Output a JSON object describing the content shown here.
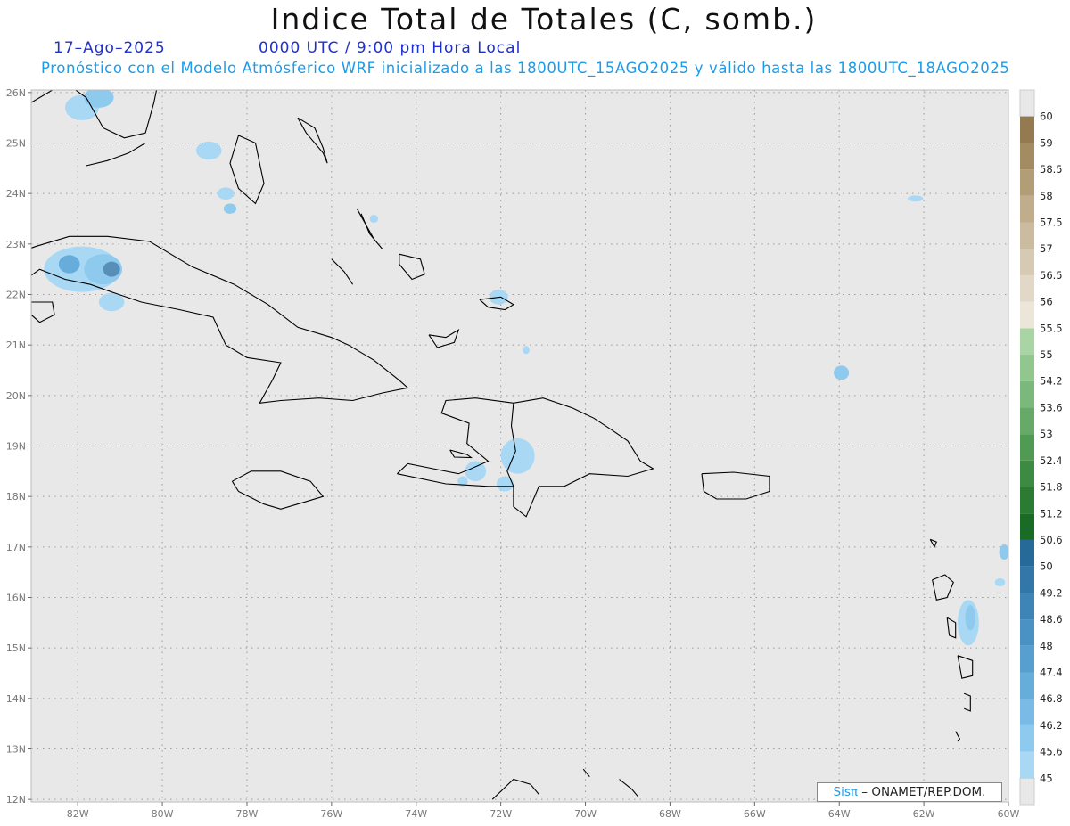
{
  "title": "Indice Total de Totales (C, somb.)",
  "date": "17–Ago–2025",
  "time": "0000 UTC / 9:00 pm Hora Local",
  "subtitle": "Pronóstico con el Modelo Atmósferico WRF inicializado a las 1800UTC_15AGO2025 y válido hasta las  1800UTC_18AGO2025",
  "credit_brand": "Sisπ",
  "credit_text": " – ONAMET/REP.DOM.",
  "map": {
    "lon_labels": [
      "82W",
      "80W",
      "78W",
      "76W",
      "74W",
      "72W",
      "70W",
      "68W",
      "66W",
      "64W",
      "62W",
      "60W"
    ],
    "lat_labels": [
      "26N",
      "25N",
      "24N",
      "23N",
      "22N",
      "21N",
      "20N",
      "19N",
      "18N",
      "17N",
      "16N",
      "15N",
      "14N",
      "13N",
      "12N"
    ],
    "lon_range": [
      -83.1,
      -60.0
    ],
    "lat_range": [
      11.95,
      26.05
    ],
    "background": "#e8e8e8",
    "coast_color": "#000000"
  },
  "colorbar": {
    "levels": [
      "45",
      "45.6",
      "46.2",
      "46.8",
      "47.4",
      "48",
      "48.6",
      "49.2",
      "50",
      "50.6",
      "51.2",
      "51.8",
      "52.4",
      "53",
      "53.6",
      "54.2",
      "55",
      "55.5",
      "56",
      "56.5",
      "57",
      "57.5",
      "58",
      "58.5",
      "59",
      "60"
    ],
    "colors": [
      "#a8d8f4",
      "#8ec9ee",
      "#78bbe6",
      "#66addb",
      "#579fcf",
      "#4a92c3",
      "#3e84b6",
      "#3277a8",
      "#256a99",
      "#1a6b25",
      "#2c7b33",
      "#3d8a43",
      "#519a54",
      "#66a968",
      "#7bb87c",
      "#91c68f",
      "#a9d4a4",
      "#ece6da",
      "#e1d8c8",
      "#d6cab4",
      "#cbbc9f",
      "#bfad8b",
      "#b29d77",
      "#a38b62",
      "#937a50"
    ]
  }
}
